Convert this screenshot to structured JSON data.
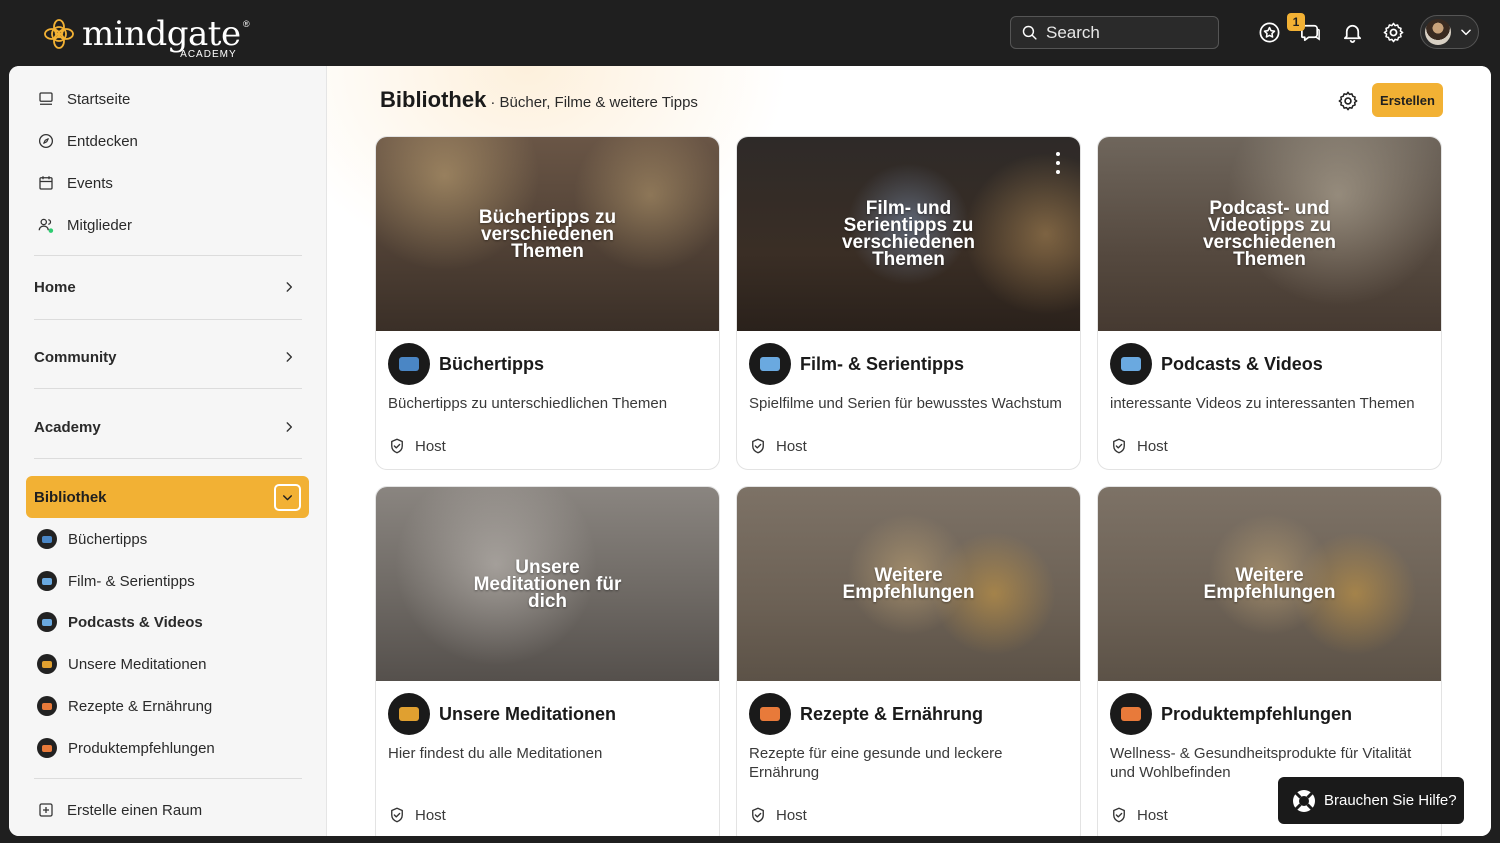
{
  "brand": {
    "name": "mindgate",
    "sub": "ACADEMY",
    "reg": "®"
  },
  "search": {
    "placeholder": "Search"
  },
  "header": {
    "notification_badge": "1"
  },
  "sidebar": {
    "top_items": [
      {
        "label": "Startseite",
        "icon": "home-icon"
      },
      {
        "label": "Entdecken",
        "icon": "compass-icon"
      },
      {
        "label": "Events",
        "icon": "calendar-icon"
      },
      {
        "label": "Mitglieder",
        "icon": "members-icon"
      }
    ],
    "sections": [
      {
        "label": "Home"
      },
      {
        "label": "Community"
      },
      {
        "label": "Academy"
      }
    ],
    "active_section": {
      "label": "Bibliothek"
    },
    "sub_items": [
      {
        "label": "Büchertipps",
        "color": "#4a86c5"
      },
      {
        "label": "Film- & Serientipps",
        "color": "#6aa9e0"
      },
      {
        "label": "Podcasts & Videos",
        "color": "#6aa9e0"
      },
      {
        "label": "Unsere Meditationen",
        "color": "#e0a030"
      },
      {
        "label": "Rezepte & Ernährung",
        "color": "#e87a3a"
      },
      {
        "label": "Produktempfehlungen",
        "color": "#e87a3a"
      }
    ],
    "create_space": "Erstelle einen Raum"
  },
  "main": {
    "title": "Bibliothek",
    "subtitle": "· Bücher, Filme & weitere Tipps",
    "create_label": "Erstellen",
    "cards": [
      {
        "image_text": "Büchertipps zu verschiedenen Themen",
        "title": "Büchertipps",
        "description": "Büchertipps zu unterschiedlichen Themen",
        "host": "Host",
        "icon_color": "#4a86c5"
      },
      {
        "image_text": "Film- und Serientipps zu verschiedenen Themen",
        "title": "Film- & Serientipps",
        "description": "Spielfilme und Serien für bewusstes Wachstum",
        "host": "Host",
        "icon_color": "#6aa9e0"
      },
      {
        "image_text": "Podcast- und Videotipps zu verschiedenen Themen",
        "title": "Podcasts & Videos",
        "description": "interessante Videos zu interessanten Themen",
        "host": "Host",
        "icon_color": "#6aa9e0"
      },
      {
        "image_text": "Unsere Meditationen für dich",
        "title": "Unsere Meditationen",
        "description": "Hier findest du alle Meditationen",
        "host": "Host",
        "icon_color": "#e0a030"
      },
      {
        "image_text": "Weitere Empfehlungen",
        "title": "Rezepte & Ernährung",
        "description": "Rezepte für eine gesunde und leckere Ernährung",
        "host": "Host",
        "icon_color": "#e87a3a"
      },
      {
        "image_text": "Weitere Empfehlungen",
        "title": "Produktempfehlungen",
        "description": "Wellness- & Gesundheitsprodukte für Vitalität und Wohlbefinden",
        "host": "Host",
        "icon_color": "#e87a3a"
      }
    ]
  },
  "help": {
    "label": "Brauchen Sie Hilfe?"
  },
  "colors": {
    "accent": "#f2b134",
    "topbar": "#1f1f1f",
    "online": "#2ecc71"
  }
}
